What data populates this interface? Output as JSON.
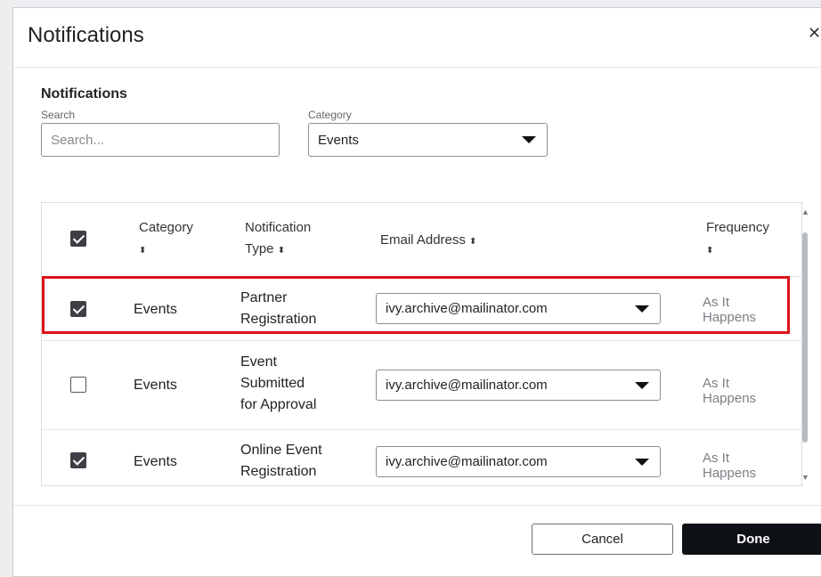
{
  "dialog": {
    "title": "Notifications",
    "close_glyph": "✕"
  },
  "filters": {
    "section_title": "Notifications",
    "search_label": "Search",
    "search_placeholder": "Search...",
    "category_label": "Category",
    "category_value": "Events"
  },
  "table": {
    "headers": {
      "category": "Category",
      "notification_type_1": "Notification",
      "notification_type_2": "Type",
      "email": "Email Address",
      "frequency": "Frequency",
      "sort_glyph": "⬍"
    },
    "rows": [
      {
        "checked": true,
        "category": "Events",
        "type_lines": [
          "Partner",
          "Registration"
        ],
        "email": "ivy.archive@mailinator.com",
        "freq_lines": [
          "As It",
          "Happens"
        ],
        "highlighted": true
      },
      {
        "checked": false,
        "category": "Events",
        "type_lines": [
          "Event",
          "Submitted",
          "for Approval"
        ],
        "email": "ivy.archive@mailinator.com",
        "freq_lines": [
          "As It",
          "Happens"
        ],
        "highlighted": false
      },
      {
        "checked": true,
        "category": "Events",
        "type_lines": [
          "Online Event",
          "Registration"
        ],
        "email": "ivy.archive@mailinator.com",
        "freq_lines": [
          "As It",
          "Happens"
        ],
        "highlighted": false
      }
    ]
  },
  "footer": {
    "cancel_label": "Cancel",
    "done_label": "Done"
  },
  "colors": {
    "highlight": "#e0121a",
    "done_bg": "#0d1015",
    "checkbox_on": "#3d3f44"
  },
  "icons": {
    "close": "close-icon",
    "sort": "sort-icon",
    "dropdown": "chevron-down-icon",
    "checkbox": "checkbox-icon"
  }
}
